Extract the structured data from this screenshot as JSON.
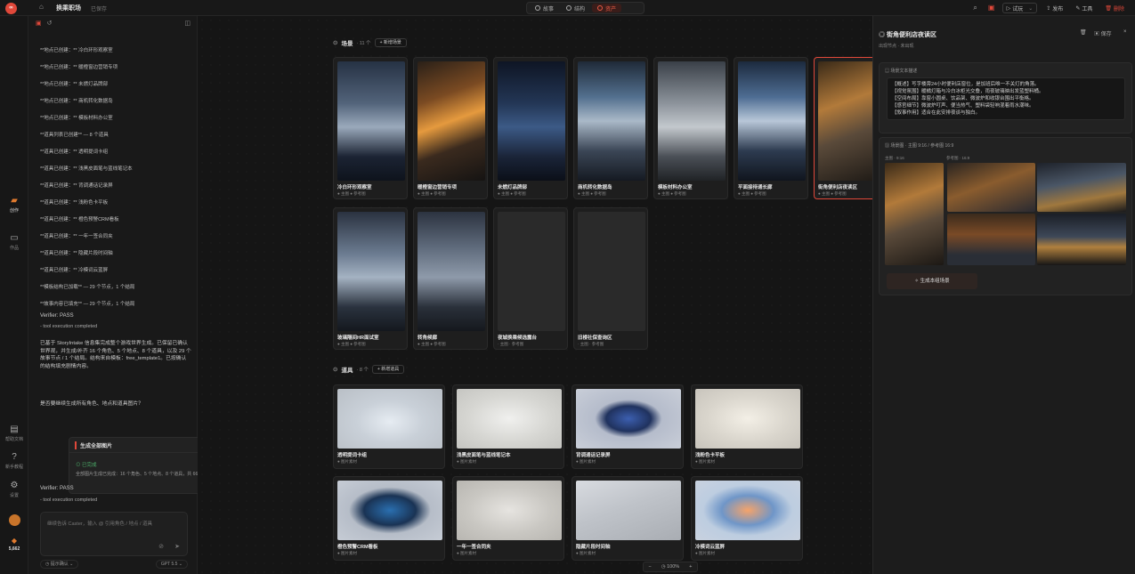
{
  "topbar": {
    "logo": "∞",
    "project_title": "换乘职场",
    "project_status": "已保存",
    "tabs": [
      {
        "label": "故事",
        "active": false
      },
      {
        "label": "结构",
        "active": false
      },
      {
        "label": "资产",
        "active": true
      }
    ],
    "play_label": "试玩",
    "publish_label": "发布",
    "tools_label": "工具",
    "delete_label": "删除"
  },
  "rail": {
    "create_label": "创作",
    "works_label": "作品",
    "help_label": "帮助文档",
    "newbie_label": "新手教程",
    "settings_label": "设置",
    "credits": "5,662"
  },
  "chat": {
    "log_lines": [
      "**地点已创建：** 冷白环形观察室",
      "**地点已创建：** 暖橙窗边营销专项",
      "**地点已创建：** 未燃灯品牌部",
      "**地点已创建：** 商机转化数据岛",
      "**地点已创建：** 模板材料办公室",
      "**道具列表已创建** — 8 个道具",
      "**道具已创建：** 透明提词卡组",
      "**道具已创建：** 浅黑皮面笔与蓝线笔记本",
      "**道具已创建：** 背调通话记录屏",
      "**道具已创建：** 浅粉色卡平板",
      "**道具已创建：** 橙色预警CRM看板",
      "**道具已创建：** 一年一签合同夹",
      "**道具已创建：** 隐藏片段时间轴",
      "**道具已创建：** 冷模词云蓝屏",
      "**模板结构已加载** — 29 个节点，1 个结局",
      "**故事内容已填充** — 29 个节点，1 个结局"
    ],
    "verifier_1": "Verifier: PASS",
    "tool_done_1": "- tool execution completed",
    "summary": "已基于 StoryIntake 信息集完成整个游戏世界生成。已保留已确认世界观，并生成/补齐 16 个角色、5 个地点、8 个道具，以及 29 个故事节点 / 1 个结局。结构来自模板：free_template1。已按确认的结构填充剧情内容。",
    "question": "是否要继续生成所有角色、地点和道具图片？",
    "gen_card": {
      "title": "生成全部图片",
      "status": "已完成",
      "desc": "全部图片生成已完成：16 个角色、5 个地点、8 个道具，共 66 张。"
    },
    "verifier_2": "Verifier: PASS",
    "tool_done_2": "- tool execution completed",
    "input_placeholder": "继续告诉 Caster，输入 @ 引用角色 / 地点 / 道具",
    "mode_label": "提示确认",
    "model_label": "GPT 5.5"
  },
  "scenes": {
    "title": "场景",
    "count": "· 11 个",
    "add_label": "+ 新增场景",
    "items": [
      {
        "name": "冷白环形观察室",
        "tag": "● 主图 ● 参考图",
        "palette": "g1"
      },
      {
        "name": "暖橙窗边营销专项",
        "tag": "● 主图 ● 参考图",
        "palette": "g2"
      },
      {
        "name": "未燃灯品牌部",
        "tag": "● 主图 ● 参考图",
        "palette": "g3"
      },
      {
        "name": "商机转化数据岛",
        "tag": "● 主图 ● 参考图",
        "palette": "g4"
      },
      {
        "name": "模板材料办公室",
        "tag": "● 主图 ● 参考图",
        "palette": "g5"
      },
      {
        "name": "平面接待通长廊",
        "tag": "● 主图 ● 参考图",
        "palette": "g6"
      },
      {
        "name": "街角便利店夜读区",
        "tag": "● 主图 ● 参考图",
        "palette": "g7"
      },
      {
        "name": "玻璃隔间HR面试室",
        "tag": "● 主图 ● 参考图",
        "palette": "g8"
      },
      {
        "name": "转角候廊",
        "tag": "● 主图 ● 参考图",
        "palette": "g9"
      },
      {
        "name": "夜城换乘候选露台",
        "tag": "· 主图 · 参考图",
        "palette": "g10"
      },
      {
        "name": "旧楼社保查询区",
        "tag": "· 主图 · 参考图",
        "palette": "g10"
      }
    ]
  },
  "props": {
    "title": "道具",
    "count": "· 8 个",
    "add_label": "+ 新增道具",
    "items": [
      {
        "name": "透明提词卡组",
        "tag": "● 图片素材",
        "palette": "p1"
      },
      {
        "name": "浅黑皮面笔与蓝线笔记本",
        "tag": "● 图片素材",
        "palette": "p2"
      },
      {
        "name": "背调通话记录屏",
        "tag": "● 图片素材",
        "palette": "p3"
      },
      {
        "name": "浅粉色卡平板",
        "tag": "● 图片素材",
        "palette": "p4"
      },
      {
        "name": "橙色预警CRM看板",
        "tag": "● 图片素材",
        "palette": "p5"
      },
      {
        "name": "一年一签合同夹",
        "tag": "● 图片素材",
        "palette": "p6"
      },
      {
        "name": "隐藏片段时间轴",
        "tag": "● 图片素材",
        "palette": "p7"
      },
      {
        "name": "冷模词云蓝屏",
        "tag": "● 图片素材",
        "palette": "p8"
      }
    ]
  },
  "zoom": {
    "minus": "−",
    "value": "100%",
    "plus": "+"
  },
  "detail": {
    "title": "街角便利店夜读区",
    "subtitle": "出现节点 · 未出现",
    "save_label": "保存",
    "desc_label": "场景文本描述",
    "desc_lines": [
      "【概述】写字楼旁24小时便利店窗位，是加班后唯一不关灯的角落。",
      "【视觉氛围】暖橘灯箱与冷白冰柜光交叠，雨夜玻璃映出发蓝塑料桶。",
      "【空间布局】靠窗小圆桌、饮品架、微波炉和收银台围出平衡格。",
      "【感官细节】微波炉叮声、便当热气、塑料袋轻响混着雨水潮味。",
      "【叙事作用】适合在此安排夜谈与独白。"
    ],
    "img_label": "场景图 · 主图 9:16 / 参考图 16:9",
    "main_ratio": "主图 · 9:16",
    "ref_ratio": "参考图 · 16:9",
    "gen_btn": "生成本组场景"
  }
}
